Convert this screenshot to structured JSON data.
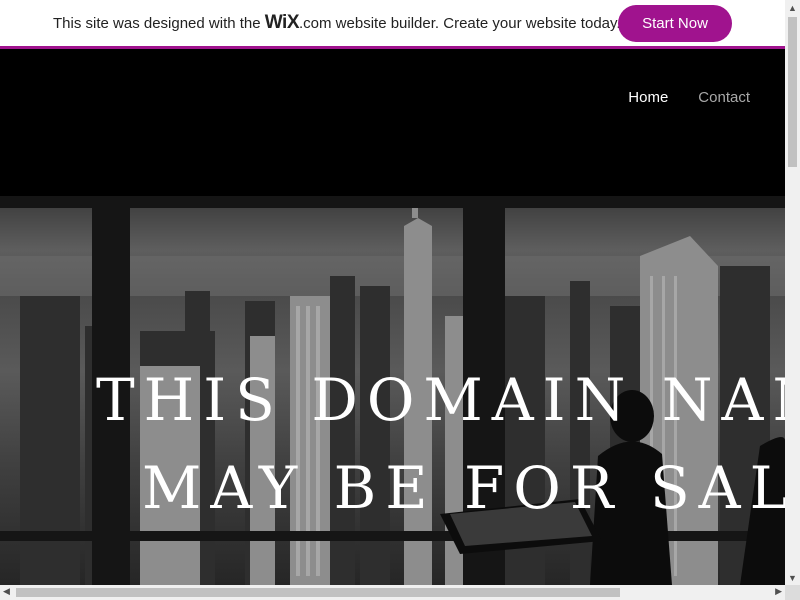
{
  "banner": {
    "text_prefix": "This site was designed with the ",
    "logo_wix": "WiX",
    "logo_suffix": ".com",
    "text_suffix": " website builder. Create your website today.",
    "cta_label": "Start Now",
    "accent_color": "#a0138e"
  },
  "nav": {
    "items": [
      {
        "label": "Home"
      },
      {
        "label": "Contact"
      }
    ]
  },
  "hero": {
    "line1": "THIS DOMAIN NAME",
    "line2": "MAY BE FOR SALE"
  },
  "icons": {
    "scroll_up": "arrow-up-icon",
    "scroll_down": "arrow-down-icon",
    "scroll_left": "arrow-left-icon",
    "scroll_right": "arrow-right-icon"
  }
}
